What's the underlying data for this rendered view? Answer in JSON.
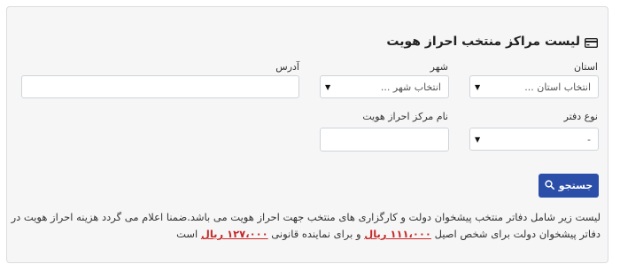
{
  "form": {
    "title": "لیست مراکز منتخب احراز هویت",
    "title_icon": "credit-card-icon",
    "province": {
      "label": "استان",
      "value": "انتخاب استان ..."
    },
    "city": {
      "label": "شهر",
      "value": "انتخاب شهر ..."
    },
    "address": {
      "label": "آدرس",
      "value": ""
    },
    "office_type": {
      "label": "نوع دفتر",
      "value": "-"
    },
    "center_name": {
      "label": "نام مرکز احراز هویت",
      "value": ""
    },
    "search_button": {
      "label": "جستجو",
      "icon": "search-icon"
    }
  },
  "description": {
    "part1": "لیست زیر شامل دفاتر منتخب پیشخوان دولت و کارگزاری های منتخب جهت احراز هویت می باشد.ضمنا اعلام می گردد هزینه احراز هویت در دفاتر پیشخوان دولت برای شخص اصیل",
    "price1": "۱۱۱،۰۰۰ ریال",
    "part2": "و برای نماینده قانونی",
    "price2": "۱۲۷،۰۰۰ ریال",
    "part3": "است"
  },
  "colors": {
    "primary_button": "#2b4fa8",
    "price_text": "#c62828",
    "panel_background": "#f6f6f7"
  }
}
